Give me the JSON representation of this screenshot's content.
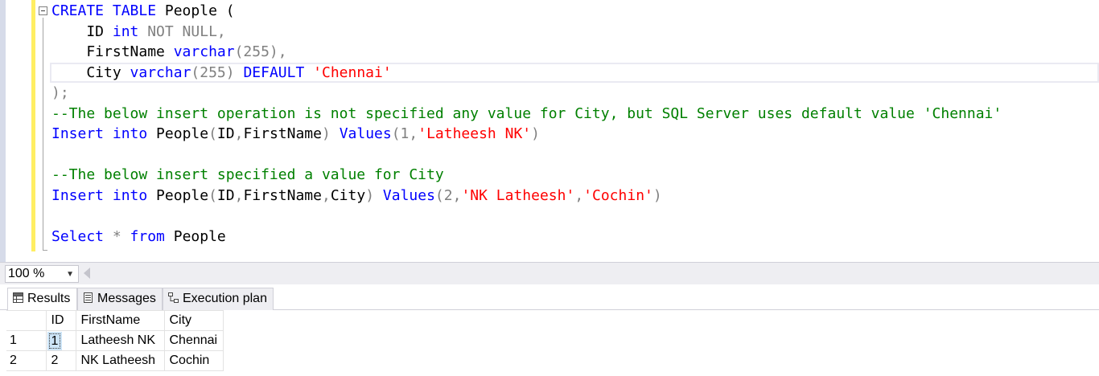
{
  "editor": {
    "lines": [
      [
        {
          "t": "CREATE TABLE",
          "c": "kw"
        },
        {
          "t": " People (",
          "c": "pl"
        }
      ],
      [
        {
          "t": "    ID ",
          "c": "pl"
        },
        {
          "t": "int",
          "c": "kw"
        },
        {
          "t": " NOT NULL,",
          "c": "gr"
        }
      ],
      [
        {
          "t": "    FirstName ",
          "c": "pl"
        },
        {
          "t": "varchar",
          "c": "kw"
        },
        {
          "t": "(255),",
          "c": "gr"
        }
      ],
      [
        {
          "t": "    City ",
          "c": "pl"
        },
        {
          "t": "varchar",
          "c": "kw"
        },
        {
          "t": "(255) ",
          "c": "gr"
        },
        {
          "t": "DEFAULT",
          "c": "kw"
        },
        {
          "t": " ",
          "c": "pl"
        },
        {
          "t": "'Chennai'",
          "c": "st"
        }
      ],
      [
        {
          "t": ");",
          "c": "gr"
        }
      ],
      [
        {
          "t": "--The below insert operation is not specified any value for City, but SQL Server uses default value 'Chennai'",
          "c": "cm"
        }
      ],
      [
        {
          "t": "Insert into",
          "c": "kw"
        },
        {
          "t": " People",
          "c": "pl"
        },
        {
          "t": "(",
          "c": "gr"
        },
        {
          "t": "ID",
          "c": "pl"
        },
        {
          "t": ",",
          "c": "gr"
        },
        {
          "t": "FirstName",
          "c": "pl"
        },
        {
          "t": ") ",
          "c": "gr"
        },
        {
          "t": "Values",
          "c": "kw"
        },
        {
          "t": "(1,",
          "c": "gr"
        },
        {
          "t": "'Latheesh NK'",
          "c": "st"
        },
        {
          "t": ")",
          "c": "gr"
        }
      ],
      [],
      [
        {
          "t": "--The below insert specified a value for City",
          "c": "cm"
        }
      ],
      [
        {
          "t": "Insert into",
          "c": "kw"
        },
        {
          "t": " People",
          "c": "pl"
        },
        {
          "t": "(",
          "c": "gr"
        },
        {
          "t": "ID",
          "c": "pl"
        },
        {
          "t": ",",
          "c": "gr"
        },
        {
          "t": "FirstName",
          "c": "pl"
        },
        {
          "t": ",",
          "c": "gr"
        },
        {
          "t": "City",
          "c": "pl"
        },
        {
          "t": ") ",
          "c": "gr"
        },
        {
          "t": "Values",
          "c": "kw"
        },
        {
          "t": "(2,",
          "c": "gr"
        },
        {
          "t": "'NK Latheesh'",
          "c": "st"
        },
        {
          "t": ",",
          "c": "gr"
        },
        {
          "t": "'Cochin'",
          "c": "st"
        },
        {
          "t": ")",
          "c": "gr"
        }
      ],
      [],
      [
        {
          "t": "Select",
          "c": "kw"
        },
        {
          "t": " * ",
          "c": "gr"
        },
        {
          "t": "from",
          "c": "kw"
        },
        {
          "t": " People",
          "c": "pl"
        }
      ]
    ]
  },
  "zoom": {
    "value": "100 %"
  },
  "tabs": [
    {
      "label": "Results",
      "icon": "grid-icon"
    },
    {
      "label": "Messages",
      "icon": "messages-icon"
    },
    {
      "label": "Execution plan",
      "icon": "execution-plan-icon"
    }
  ],
  "grid": {
    "columns": [
      "ID",
      "FirstName",
      "City"
    ],
    "rows": [
      {
        "num": "1",
        "cells": [
          "1",
          "Latheesh NK",
          "Chennai"
        ]
      },
      {
        "num": "2",
        "cells": [
          "2",
          "NK Latheesh",
          "Cochin"
        ]
      }
    ]
  },
  "colors": {
    "keyword": "#0000ff",
    "operator": "#808080",
    "string": "#ff0000",
    "comment": "#008000",
    "selected_cell": "#cce4f7",
    "editor_margin": "#ffee62"
  }
}
